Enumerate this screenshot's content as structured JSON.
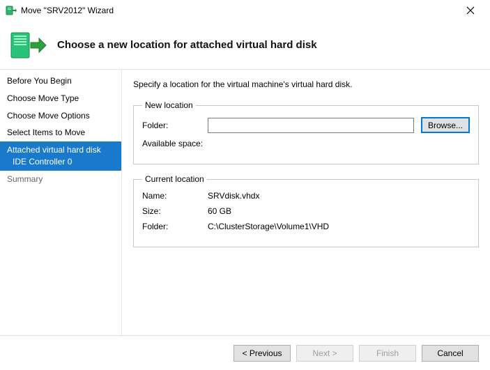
{
  "titlebar": {
    "title": "Move \"SRV2012\" Wizard"
  },
  "banner": {
    "heading": "Choose a new location for attached virtual hard disk"
  },
  "sidebar": {
    "items": [
      {
        "label": "Before You Begin"
      },
      {
        "label": "Choose Move Type"
      },
      {
        "label": "Choose Move Options"
      },
      {
        "label": "Select Items to Move"
      },
      {
        "label": "Attached virtual hard disk",
        "sub": "IDE Controller 0",
        "selected": true
      },
      {
        "label": "Summary",
        "muted": true
      }
    ]
  },
  "content": {
    "instruction": "Specify a location for the virtual machine's virtual hard disk.",
    "newloc": {
      "legend": "New location",
      "folder_label": "Folder:",
      "folder_value": "",
      "browse_label": "Browse...",
      "space_label": "Available space:",
      "space_value": ""
    },
    "curloc": {
      "legend": "Current location",
      "name_label": "Name:",
      "name_value": "SRVdisk.vhdx",
      "size_label": "Size:",
      "size_value": "60 GB",
      "folder_label": "Folder:",
      "folder_value": "C:\\ClusterStorage\\Volume1\\VHD"
    }
  },
  "buttons": {
    "prev": "< Previous",
    "next": "Next >",
    "finish": "Finish",
    "cancel": "Cancel"
  }
}
